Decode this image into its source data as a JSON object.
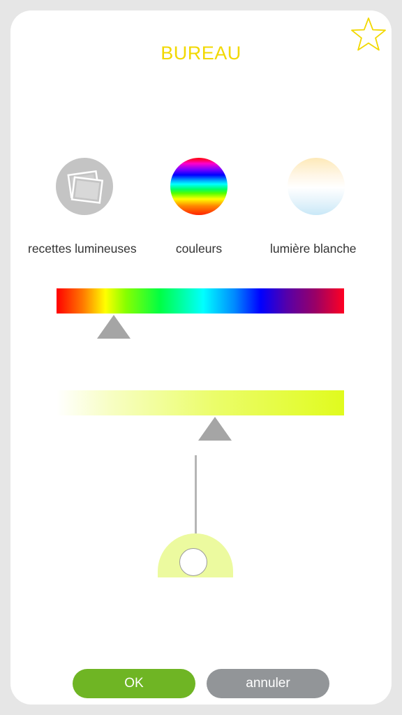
{
  "header": {
    "title": "BUREAU"
  },
  "modes": [
    {
      "label": "recettes lumineuses",
      "icon": "photos-icon"
    },
    {
      "label": "couleurs",
      "icon": "color-spectrum-icon"
    },
    {
      "label": "lumière blanche",
      "icon": "white-light-icon"
    }
  ],
  "sliders": {
    "hue": {
      "position": 0.2
    },
    "saturation": {
      "position": 0.55
    },
    "brightness": {
      "position": 0.5
    }
  },
  "buttons": {
    "ok": "OK",
    "cancel": "annuler"
  },
  "colors": {
    "accent": "#f2d800",
    "ok": "#6fb524",
    "cancel": "#929598",
    "pointer": "#a5a5a5"
  }
}
